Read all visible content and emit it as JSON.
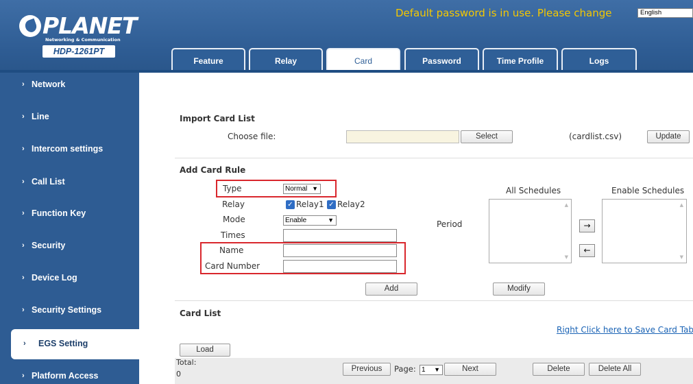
{
  "header": {
    "logo_text": "PLANET",
    "logo_sub": "Networking & Communication",
    "model": "HDP-1261PT",
    "warning": "Default password is in use. Please change",
    "language": "English"
  },
  "tabs": [
    {
      "label": "Feature"
    },
    {
      "label": "Relay"
    },
    {
      "label": "Card"
    },
    {
      "label": "Password"
    },
    {
      "label": "Time Profile"
    },
    {
      "label": "Logs"
    }
  ],
  "sidebar": {
    "items": [
      {
        "label": "Network"
      },
      {
        "label": "Line"
      },
      {
        "label": "Intercom settings"
      },
      {
        "label": "Call List"
      },
      {
        "label": "Function Key"
      },
      {
        "label": "Security"
      },
      {
        "label": "Device Log"
      },
      {
        "label": "Security Settings"
      },
      {
        "label": "EGS Setting"
      },
      {
        "label": "Platform Access"
      }
    ],
    "chevron": "›"
  },
  "import": {
    "title": "Import Card List",
    "choose_file_label": "Choose file:",
    "select_button": "Select",
    "file_hint": "(cardlist.csv)",
    "update_button": "Update"
  },
  "rule": {
    "title": "Add Card Rule",
    "type_label": "Type",
    "type_value": "Normal",
    "relay_label": "Relay",
    "relay1": "Relay1",
    "relay2": "Relay2",
    "mode_label": "Mode",
    "mode_value": "Enable",
    "times_label": "Times",
    "name_label": "Name",
    "card_number_label": "Card Number",
    "period_label": "Period",
    "all_schedules_label": "All Schedules",
    "enable_schedules_label": "Enable Schedules",
    "add_button": "Add",
    "modify_button": "Modify",
    "right_arrow": "→",
    "left_arrow": "←"
  },
  "card_list": {
    "title": "Card List",
    "save_link": "Right Click here to Save Card Table",
    "load_button": "Load",
    "total_label": "Total:",
    "total_value": "0",
    "previous_button": "Previous",
    "page_label": "Page:",
    "page_value": "1",
    "next_button": "Next",
    "delete_button": "Delete",
    "delete_all_button": "Delete All"
  }
}
